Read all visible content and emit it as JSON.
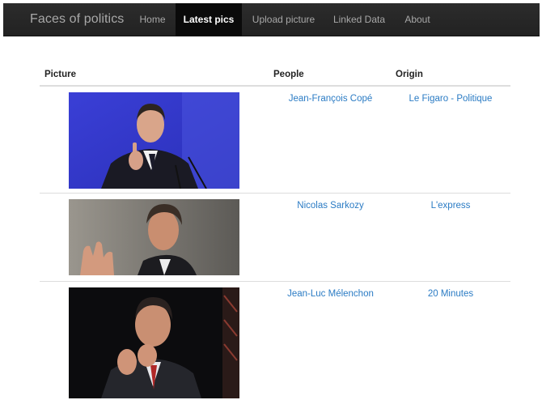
{
  "navbar": {
    "brand": "Faces of politics",
    "items": [
      {
        "label": "Home",
        "active": false
      },
      {
        "label": "Latest pics",
        "active": true
      },
      {
        "label": "Upload picture",
        "active": false
      },
      {
        "label": "Linked Data",
        "active": false
      },
      {
        "label": "About",
        "active": false
      }
    ]
  },
  "table": {
    "headers": {
      "picture": "Picture",
      "people": "People",
      "origin": "Origin"
    },
    "rows": [
      {
        "people": "Jean-François Copé",
        "origin": "Le Figaro - Politique"
      },
      {
        "people": "Nicolas Sarkozy",
        "origin": "L'express"
      },
      {
        "people": "Jean-Luc Mélenchon",
        "origin": "20 Minutes"
      }
    ]
  },
  "colors": {
    "navbar": "#222222",
    "active_nav": "#0a0a0a",
    "link": "#2a7bc4",
    "border": "#dddddd"
  }
}
